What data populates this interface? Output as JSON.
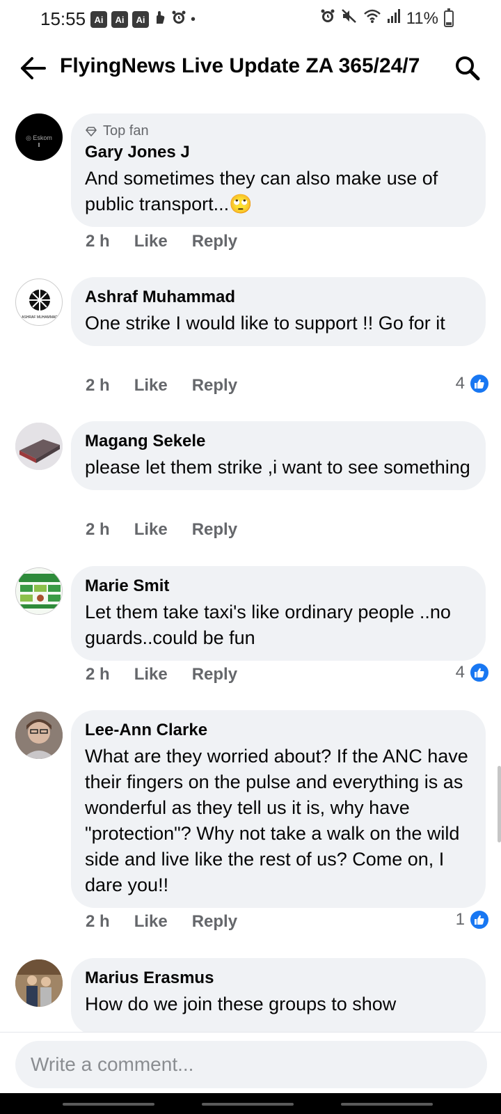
{
  "status_bar": {
    "time": "15:55",
    "ai_badges": [
      "Ai",
      "Ai",
      "Ai"
    ],
    "battery": "11%",
    "icons": [
      "alarm-icon",
      "mute-icon",
      "wifi-icon",
      "signal-icon",
      "battery-icon"
    ]
  },
  "header": {
    "title": "FlyingNews Live Update ZA 365/24/7",
    "back_icon": "arrow-left-icon",
    "search_icon": "search-icon"
  },
  "comments": [
    {
      "badge": "Top fan",
      "author": "Gary Jones J",
      "text": "And sometimes they can also make use of public transport...🙄",
      "time": "2 h",
      "like_label": "Like",
      "reply_label": "Reply",
      "reactions": ""
    },
    {
      "author": "Ashraf Muhammad",
      "text": "One strike I would like to support !! Go for it",
      "time": "2 h",
      "like_label": "Like",
      "reply_label": "Reply",
      "reactions": "4"
    },
    {
      "author": "Magang Sekele",
      "text": "please let them strike ,i want to see something",
      "time": "2 h",
      "like_label": "Like",
      "reply_label": "Reply",
      "reactions": ""
    },
    {
      "author": "Marie Smit",
      "text": "Let them take taxi's like ordinary people ..no guards..could be fun",
      "time": "2 h",
      "like_label": "Like",
      "reply_label": "Reply",
      "reactions": "4"
    },
    {
      "author": "Lee-Ann Clarke",
      "text": "What are they worried about?   If the ANC have their fingers on the pulse and everything is as wonderful as they tell us it is, why have \"protection\"?   Why not take a walk on the wild side and live like the rest of us? Come on, I dare you!!",
      "time": "2 h",
      "like_label": "Like",
      "reply_label": "Reply",
      "reactions": "1"
    },
    {
      "author": "Marius Erasmus",
      "text": "How do we join these groups to show"
    }
  ],
  "composer": {
    "placeholder": "Write a comment..."
  },
  "colors": {
    "bubble": "#f0f2f5",
    "meta_text": "#65676b",
    "like_blue": "#1877f2"
  }
}
